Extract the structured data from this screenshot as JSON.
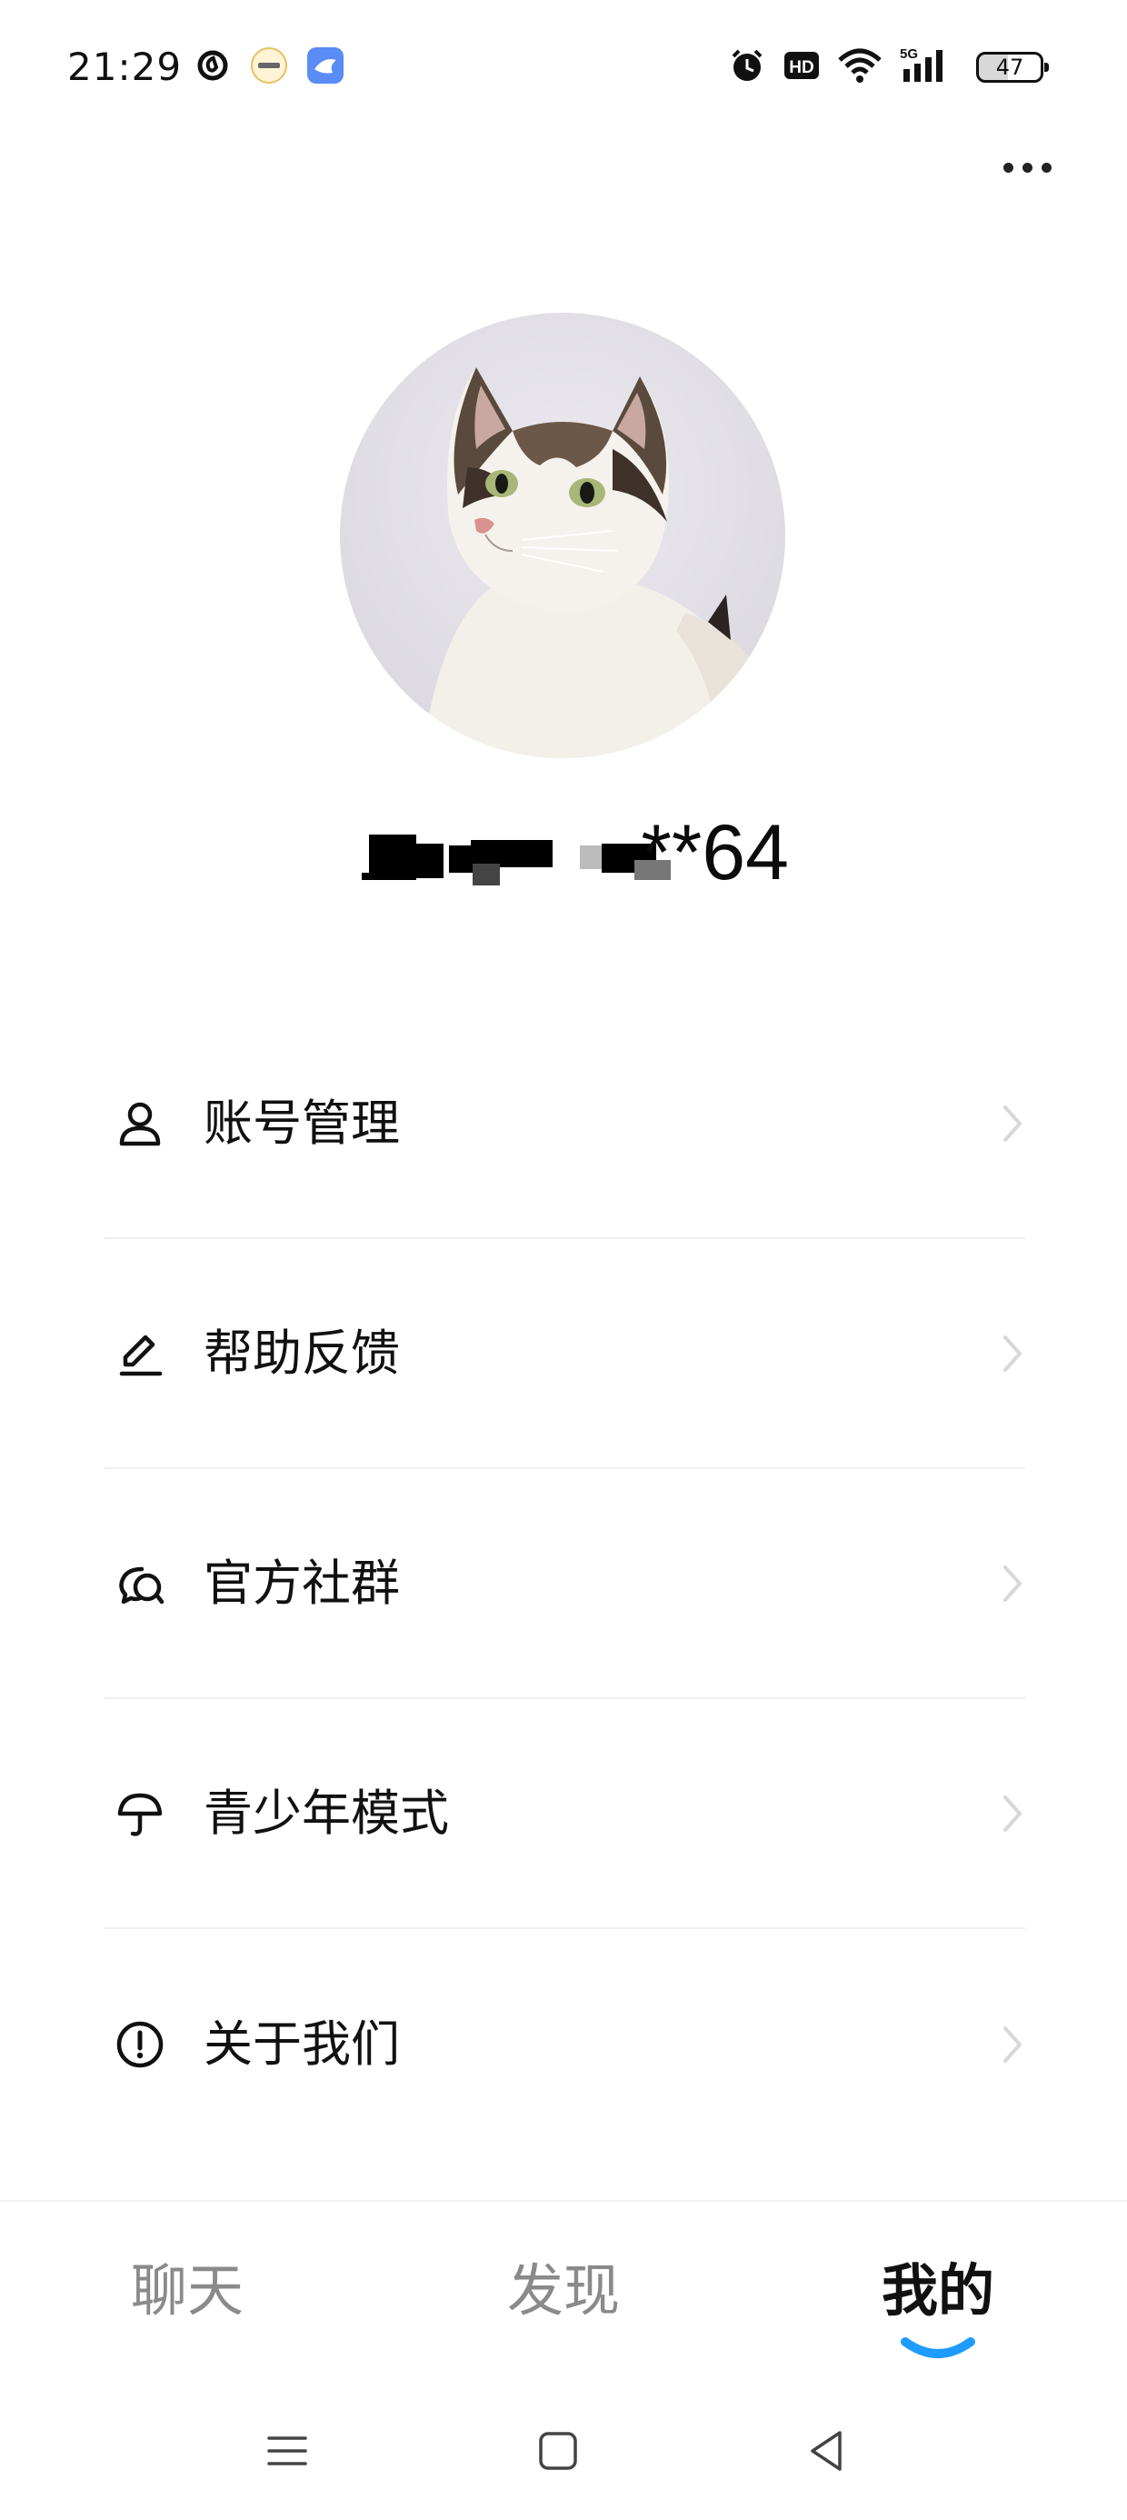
{
  "status_bar": {
    "time": "21:29",
    "app_icons": [
      "netease-music-icon",
      "realme-icon",
      "bird-app-icon"
    ],
    "right_icons": [
      "alarm-icon",
      "hd-icon",
      "wifi-icon",
      "5g-signal-icon"
    ],
    "battery_level": "47",
    "hd_label": "HD",
    "network_label": "5G"
  },
  "profile": {
    "username_visible": "**64",
    "username_redacted": true
  },
  "menu": {
    "items": [
      {
        "label": "账号管理",
        "icon": "person-icon"
      },
      {
        "label": "帮助反馈",
        "icon": "pencil-icon"
      },
      {
        "label": "官方社群",
        "icon": "chat-bubbles-icon"
      },
      {
        "label": "青少年模式",
        "icon": "umbrella-icon"
      },
      {
        "label": "关于我们",
        "icon": "exclamation-circle-icon"
      }
    ]
  },
  "tabs": {
    "items": [
      {
        "label": "聊天",
        "active": false
      },
      {
        "label": "发现",
        "active": false
      },
      {
        "label": "我的",
        "active": true
      }
    ]
  },
  "colors": {
    "accent": "#1e9bff",
    "text_primary": "#111111",
    "text_inactive": "#8a8a8a",
    "divider": "#f0f0f0"
  }
}
